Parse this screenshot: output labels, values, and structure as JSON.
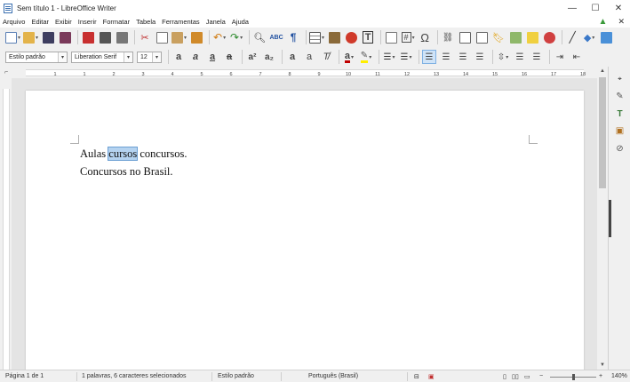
{
  "window": {
    "title": "Sem título 1 - LibreOffice Writer",
    "minimize": "—",
    "maximize": "☐",
    "close": "✕"
  },
  "menu": {
    "items": [
      "Arquivo",
      "Editar",
      "Exibir",
      "Inserir",
      "Formatar",
      "Tabela",
      "Ferramentas",
      "Janela",
      "Ajuda"
    ],
    "close_doc": "✕"
  },
  "formatting": {
    "paragraph_style": "Estilo padrão",
    "font_name": "Liberation Serif",
    "font_size": "12"
  },
  "ruler": {
    "ticks": [
      "1",
      "1",
      "2",
      "3",
      "4",
      "5",
      "6",
      "7",
      "8",
      "9",
      "10",
      "11",
      "12",
      "13",
      "14",
      "15",
      "16",
      "17",
      "18"
    ]
  },
  "document": {
    "line1_before": "Aulas ",
    "line1_selected": "cursos",
    "line1_after": " concursos.",
    "line2": "Concursos no Brasil."
  },
  "status": {
    "page": "Página 1 de 1",
    "words": "1 palavras, 6 caracteres selecionados",
    "style": "Estilo padrão",
    "language": "Português (Brasil)",
    "zoom": "140%",
    "zoom_out": "−",
    "zoom_in": "+"
  },
  "colors": {
    "accent": "#3a6fb0",
    "selection": "#b5d3f0",
    "font_color_bar": "#c00000",
    "highlight_bar": "#ffee00"
  }
}
